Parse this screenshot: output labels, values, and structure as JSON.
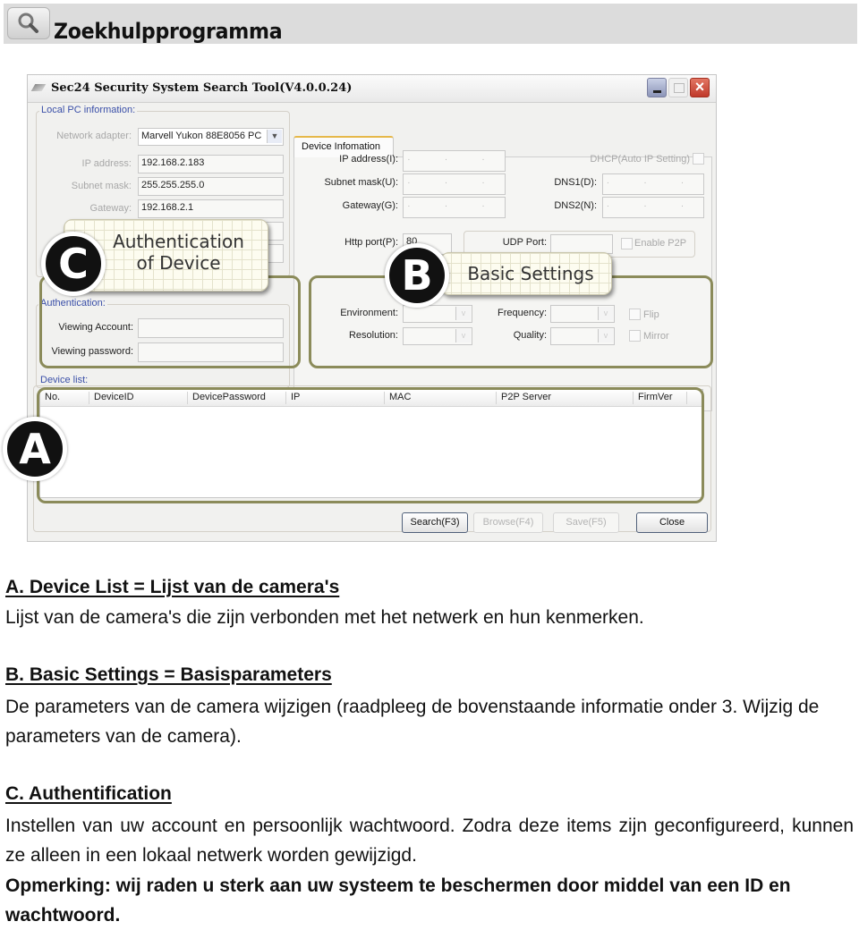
{
  "header": {
    "title": "Zoekhulpprogramma",
    "icon": "magnifier-icon"
  },
  "window": {
    "title": "Sec24 Security System Search Tool(V4.0.0.24)",
    "controls": [
      "minimize",
      "maximize",
      "close"
    ],
    "local_pc": {
      "group_label": "Local PC information:",
      "network_adapter_label": "Network adapter:",
      "network_adapter_value": "Marvell Yukon 88E8056 PC",
      "ip_label": "IP address:",
      "ip_value": "192.168.2.183",
      "subnet_label": "Subnet mask:",
      "subnet_value": "255.255.255.0",
      "gateway_label": "Gateway:",
      "gateway_value": "192.168.2.1"
    },
    "device_info": {
      "tab_label": "Device Infomation",
      "ip_label": "IP address(I):",
      "subnet_label": "Subnet mask(U):",
      "gateway_label": "Gateway(G):",
      "dhcp_label": "DHCP(Auto IP Setting)",
      "dns1_label": "DNS1(D):",
      "dns2_label": "DNS2(N):",
      "ip_placeholder": ". . .",
      "http_port_label": "Http port(P):",
      "http_port_value": "80",
      "udp_port_label": "UDP Port:",
      "enable_p2p_label": "Enable P2P",
      "environment_label": "Environment:",
      "resolution_label": "Resolution:",
      "frequency_label": "Frequency:",
      "quality_label": "Quality:",
      "flip_label": "Flip",
      "mirror_label": "Mirror"
    },
    "authentication": {
      "group_label": "Authentication:",
      "viewing_account_label": "Viewing Account:",
      "viewing_password_label": "Viewing password:"
    },
    "device_list": {
      "group_label": "Device list:",
      "columns": [
        "No.",
        "DeviceID",
        "DevicePassword",
        "IP",
        "MAC",
        "P2P Server",
        "FirmVer"
      ],
      "rows": []
    },
    "buttons": {
      "search": "Search(F3)",
      "browse": "Browse(F4)",
      "save": "Save(F5)",
      "close": "Close"
    }
  },
  "callouts": {
    "a_badge": "A",
    "b_badge": "B",
    "b_text": "Basic Settings",
    "c_badge": "C",
    "c_text_line1": "Authentication",
    "c_text_line2": "of Device"
  },
  "sections": [
    {
      "heading": "A. Device List = Lijst van de camera's",
      "body": "Lijst van de camera's die zijn verbonden met het netwerk en hun kenmerken."
    },
    {
      "heading": "B. Basic Settings = Basisparameters",
      "body": "De parameters van de camera wijzigen (raadpleeg de bovenstaande informatie onder 3. Wijzig de parameters van de camera)."
    },
    {
      "heading": "C. Authentification",
      "body": "Instellen van uw account en persoonlijk wachtwoord. Zodra deze items zijn geconfigureerd, kunnen ze alleen in een lokaal netwerk worden gewijzigd.",
      "note": "Opmerking: wij raden u sterk aan uw systeem te beschermen door middel van een ID en wachtwoord."
    }
  ]
}
